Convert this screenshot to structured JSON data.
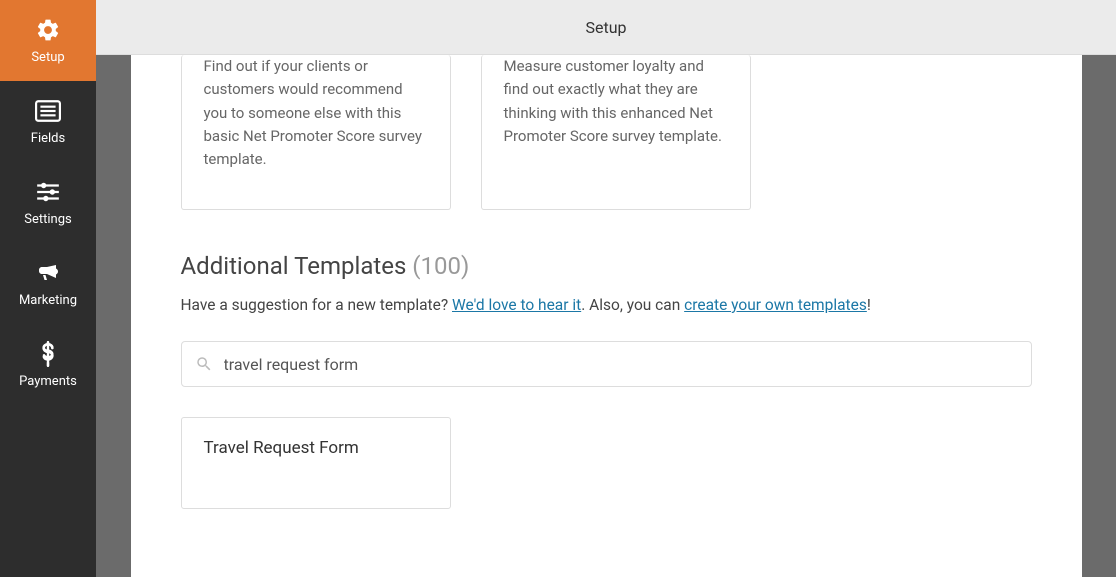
{
  "header": {
    "title": "Setup"
  },
  "sidebar": {
    "items": [
      {
        "label": "Setup"
      },
      {
        "label": "Fields"
      },
      {
        "label": "Settings"
      },
      {
        "label": "Marketing"
      },
      {
        "label": "Payments"
      }
    ]
  },
  "templates": {
    "card1": {
      "description": "Find out if your clients or customers would recommend you to someone else with this basic Net Promoter Score survey template."
    },
    "card2": {
      "description": "Measure customer loyalty and find out exactly what they are thinking with this enhanced Net Promoter Score survey template."
    }
  },
  "additional": {
    "title": "Additional Templates ",
    "count": "(100)",
    "suggestion_prefix": "Have a suggestion for a new template? ",
    "suggestion_link": "We'd love to hear it",
    "suggestion_mid": ". Also, you can ",
    "suggestion_link2": "create your own templates",
    "suggestion_suffix": "!"
  },
  "search": {
    "value": "travel request form"
  },
  "result": {
    "title": "Travel Request Form"
  }
}
